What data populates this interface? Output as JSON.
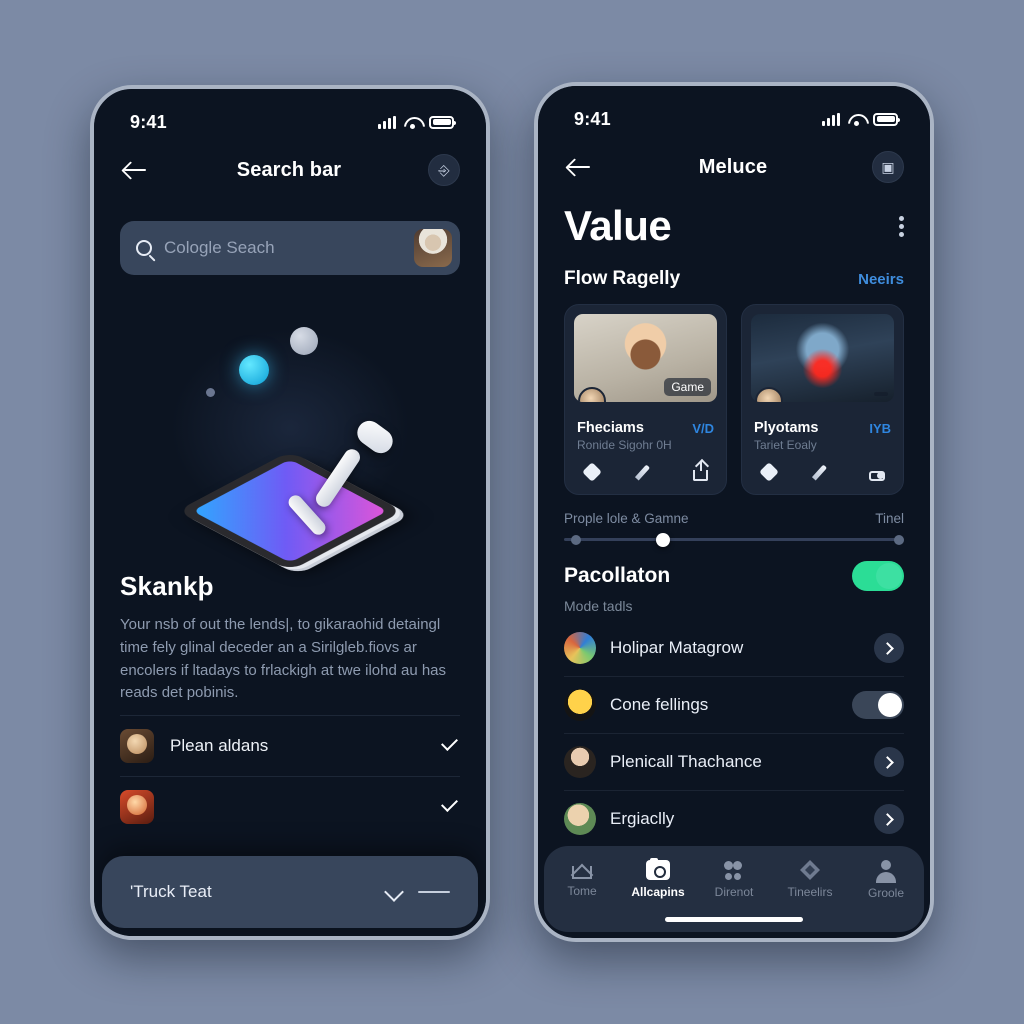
{
  "background_color": "#7c8aa5",
  "left_phone": {
    "status": {
      "time": "9:41",
      "signal_icon": "cellular-signal-icon",
      "wifi_icon": "wifi-icon",
      "battery_icon": "battery-icon"
    },
    "appbar": {
      "back_icon": "back-arrow-icon",
      "title": "Search bar",
      "action_icon": "profile-badge-icon"
    },
    "search": {
      "icon": "search-icon",
      "placeholder": "Cologle Seach",
      "avatar": "user-avatar"
    },
    "illustration": {
      "name": "isometric-tablet-illustration"
    },
    "headline": "Skankþ",
    "body": "Your nsb of out the lends|, to gikaraohid detaingl time fely glinal deceder an a Sirilgleb.fiovs ar encolers if ltadays to frlackigh at twe ilohd au has reads det pobinis.",
    "rows": [
      {
        "name": "Plean aldans",
        "trailing": "check-icon"
      }
    ],
    "sheet": {
      "title": "'Truck Teat",
      "chevron_icon": "chevron-down-icon",
      "dash_icon": "minimize-icon"
    }
  },
  "right_phone": {
    "status": {
      "time": "9:41",
      "signal_icon": "cellular-signal-icon",
      "wifi_icon": "wifi-icon",
      "battery_icon": "battery-icon"
    },
    "appbar": {
      "back_icon": "back-arrow-icon",
      "title": "Meluce",
      "action_icon": "image-badge-icon"
    },
    "page_title": "Value",
    "kebab_icon": "more-vertical-icon",
    "section": {
      "title": "Flow Ragelly",
      "link": "Neeirs",
      "link_color": "#3f8ddd"
    },
    "cards": [
      {
        "media": "woman-portrait-thumbnail",
        "badge": "Game",
        "title": "Fheciams",
        "tag": "V/D",
        "subtitle": "Ronide Sigohr 0H",
        "actions": [
          "sparkle-icon",
          "pencil-icon",
          "share-icon"
        ]
      },
      {
        "media": "game-artwork-thumbnail",
        "badge": "",
        "title": "Plyotams",
        "tag": "IYB",
        "subtitle": "Tariet Eoaly",
        "actions": [
          "sparkle-icon",
          "pencil-icon",
          "upload-icon"
        ]
      }
    ],
    "slider": {
      "left_label": "Prople lole & Gamne",
      "right_label": "Tinel",
      "value_percent": 27
    },
    "toggle_section": {
      "title": "Pacollaton",
      "enabled": true,
      "on_color": "#2bdd96",
      "sub_label": "Mode tadls"
    },
    "list": [
      {
        "name": "Holipar Matagrow",
        "control": "chevron-right-button"
      },
      {
        "name": "Cone fellings",
        "control": "plus-toggle"
      },
      {
        "name": "Plenicall Thachance",
        "control": "chevron-right-button"
      },
      {
        "name": "Ergiaclly",
        "control": "chevron-right-button"
      }
    ],
    "tabbar": [
      {
        "label": "Tome",
        "icon": "home-icon",
        "active": false
      },
      {
        "label": "Allcapins",
        "icon": "camera-icon",
        "active": true
      },
      {
        "label": "Direnot",
        "icon": "people-icon",
        "active": false
      },
      {
        "label": "Tineelirs",
        "icon": "diamond-icon",
        "active": false
      },
      {
        "label": "Groole",
        "icon": "person-icon",
        "active": false
      }
    ]
  }
}
